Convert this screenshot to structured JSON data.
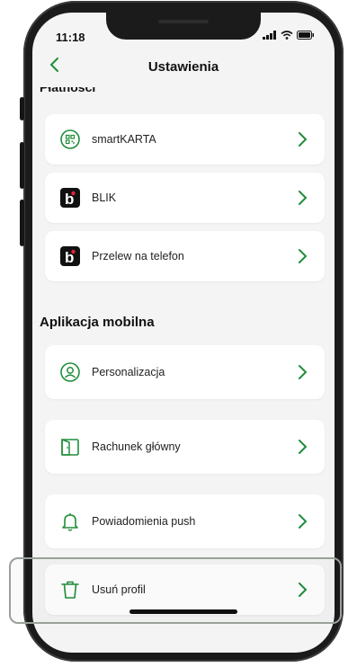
{
  "status": {
    "time": "11:18"
  },
  "header": {
    "title": "Ustawienia"
  },
  "sections": {
    "payments_partial": "Płatności",
    "mobile_app": "Aplikacja mobilna"
  },
  "payments": [
    {
      "label": "smartKARTA",
      "icon": "qr-card-icon"
    },
    {
      "label": "BLIK",
      "icon": "blik-logo-icon"
    },
    {
      "label": "Przelew na telefon",
      "icon": "blik-logo-icon"
    }
  ],
  "app": [
    {
      "label": "Personalizacja",
      "icon": "user-circle-icon"
    },
    {
      "label": "Rachunek główny",
      "icon": "account-door-icon"
    },
    {
      "label": "Powiadomienia push",
      "icon": "bell-icon"
    },
    {
      "label": "Usuń profil",
      "icon": "trash-icon"
    }
  ],
  "colors": {
    "accent": "#1f8e3a",
    "background": "#f3f4f3",
    "card": "#ffffff"
  }
}
